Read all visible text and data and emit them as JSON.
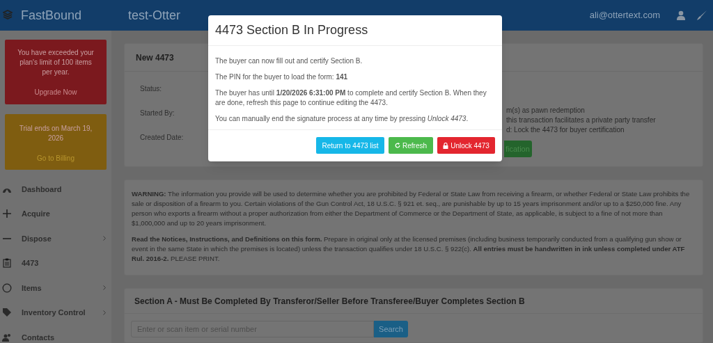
{
  "header": {
    "brand": "FastBound",
    "account": "test-Otter",
    "user_email": "ali@ottertext.com"
  },
  "sidebar": {
    "alerts": [
      {
        "kind": "limit",
        "message": "You have exceeded your plan's limit of 100 items per year.",
        "link": "Upgrade Now"
      },
      {
        "kind": "trial",
        "message": "Trial ends on March 19, 2026",
        "link": "Go to Billing"
      }
    ],
    "items": [
      {
        "label": "Dashboard",
        "has_submenu": false
      },
      {
        "label": "Acquire",
        "has_submenu": false
      },
      {
        "label": "Dispose",
        "has_submenu": true
      },
      {
        "label": "4473",
        "has_submenu": false
      },
      {
        "label": "Items",
        "has_submenu": true
      },
      {
        "label": "Inventory Control",
        "has_submenu": true
      },
      {
        "label": "Contacts",
        "has_submenu": false
      }
    ]
  },
  "form_card": {
    "title": "New 4473",
    "fields": [
      {
        "label": "Status:"
      },
      {
        "label": "Started By:"
      },
      {
        "label": "Created Date:"
      }
    ],
    "options": [
      "m(s) as pawn redemption",
      "this transaction facilitates a private party transfer",
      "d: Lock the 4473 for buyer certification"
    ],
    "button": "fication"
  },
  "warning": {
    "paragraphs": [
      "**WARNING:** The information you provide will be used to determine whether you are prohibited by Federal or State Law from receiving a firearm, or whether Federal or State Law prohibits the sale or disposition of a firearm to you. Certain violations of the Gun Control Act, 18 U.S.C. § 921 et. seq., are punishable by up to 15 years imprisonment and/or up to a $250,000 fine. Any person who exports a firearm without a proper authorization from either the Department of Commerce or the Department of State, as applicable, is subject to a fine of not more than $1,000,000 and up to 20 years imprisonment.",
      "**Read the Notices, Instructions, and Definitions on this form.** Prepare in original only at the licensed premises (including business temporarily conducted from a qualifying gun show or event in the same State in which the premises is located) unless the transaction qualifies under 18 U.S.C. § 922(c). **All entries must be handwritten in ink unless completed under ATF Rul. 2016-2.** PLEASE PRINT."
    ]
  },
  "section_a": {
    "title": "Section A - Must Be Completed By Transferor/Seller Before Transferee/Buyer Completes Section B",
    "search": {
      "placeholder": "Enter or scan item or serial number",
      "button": "Search"
    }
  },
  "modal": {
    "title": "4473 Section B In Progress",
    "paragraphs": [
      "The buyer can now fill out and certify Section B.",
      "The PIN for the buyer to load the form: **141**",
      "The buyer has until **1/20/2026 6:31:00 PM** to complete and certify Section B. When they are done, refresh this page to continue editing the 4473.",
      "You can manually end the signature process at any time by pressing *Unlock 4473*."
    ],
    "buttons": [
      {
        "label": "Return to 4473 list",
        "kind": "info"
      },
      {
        "label": "Refresh",
        "kind": "refresh"
      },
      {
        "label": "Unlock 4473",
        "kind": "unlock"
      }
    ]
  }
}
